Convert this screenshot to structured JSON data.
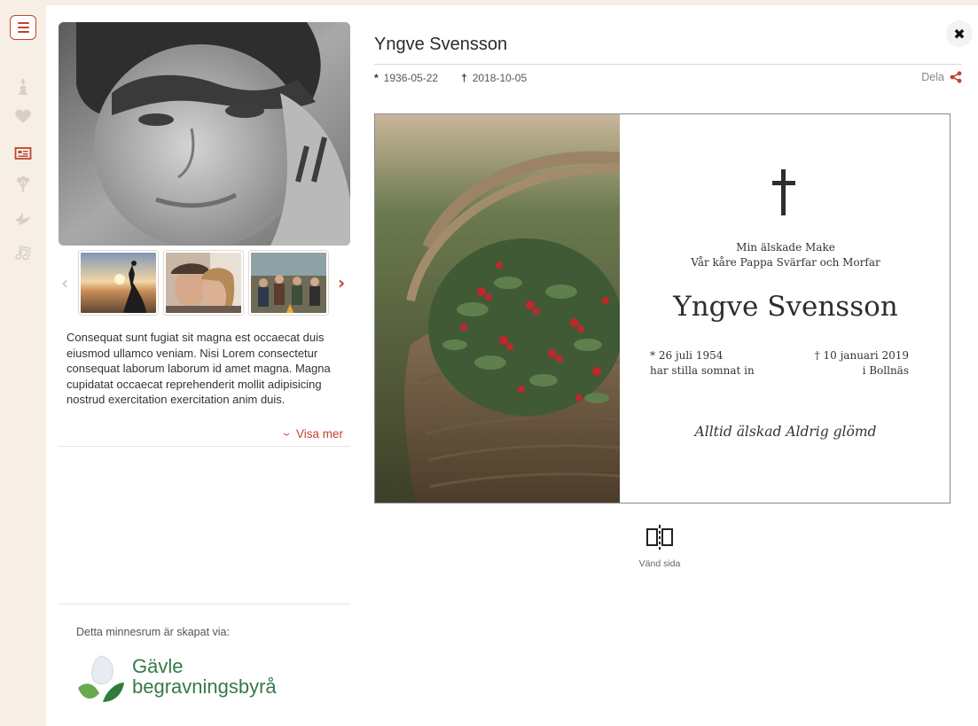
{
  "profile": {
    "name": "Yngve Svensson",
    "born": "1936-05-22",
    "died": "2018-10-05",
    "born_symbol": "*",
    "died_symbol": "†"
  },
  "header": {
    "share_label": "Dela",
    "close_label": "✖"
  },
  "gallery": {
    "prev_label": "‹",
    "next_label": "›",
    "images": [
      "sunset-dancer",
      "two-women-selfie",
      "friends-campfire"
    ]
  },
  "bio": {
    "text": "Consequat sunt fugiat sit magna est occaecat duis eiusmod ullamco veniam. Nisi Lorem consectetur consequat laborum laborum id amet magna. Magna cupidatat occaecat reprehenderit mollit adipisicing nostrud exercitation exercitation anim duis.",
    "show_more_label": "Visa mer"
  },
  "footer": {
    "created_via_label": "Detta minnesrum är skapat via:",
    "agency_line1": "Gävle",
    "agency_line2": "begravningsbyrå"
  },
  "announcement": {
    "line1": "Min älskade Make",
    "line2": "Vår kåre Pappa Svärfar och Morfar",
    "name": "Yngve Svensson",
    "birth_line1": "* 26 juli 1954",
    "birth_line2": "har stilla somnat in",
    "death_line1": "† 10 januari 2019",
    "death_line2": "i Bollnäs",
    "motto": "Alltid älskad Aldrig glömd"
  },
  "flip": {
    "label": "Vänd sida"
  },
  "colors": {
    "accent": "#c0442f",
    "sidebar_bg": "#f7efe6",
    "brand_green": "#357a46"
  }
}
